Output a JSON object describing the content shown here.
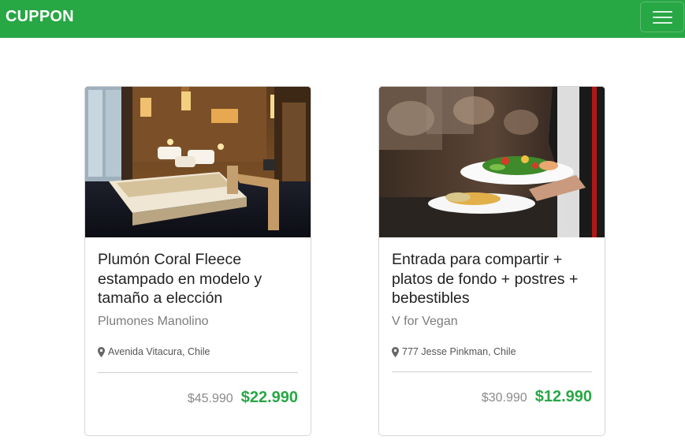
{
  "header": {
    "brand": "CUPPON",
    "menu_icon": "hamburger-icon",
    "background_color": "#28a745"
  },
  "cards": [
    {
      "title": "Plumón Coral Fleece estampado en modelo y tamaño a elección",
      "merchant": "Plumones Manolino",
      "location": "Avenida Vitacura, Chile",
      "location_icon": "map-marker-icon",
      "old_price": "$45.990",
      "new_price": "$22.990",
      "image": "hotel-bedroom-photo"
    },
    {
      "title": "Entrada para compartir + platos de fondo + postres + bebestibles",
      "merchant": "V for Vegan",
      "location": "777 Jesse Pinkman, Chile",
      "location_icon": "map-marker-icon",
      "old_price": "$30.990",
      "new_price": "$12.990",
      "image": "waiter-serving-plates-photo"
    }
  ],
  "colors": {
    "accent": "#28a745",
    "old_price": "#8a8a8a"
  }
}
